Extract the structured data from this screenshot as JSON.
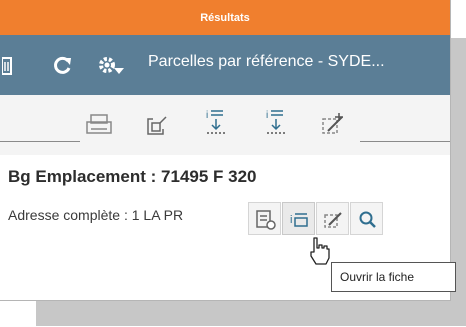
{
  "window": {
    "title": "Résultats"
  },
  "layer": {
    "title": "Parcelles par référence - SYDE..."
  },
  "record": {
    "emplacement_label": "Bg Emplacement : ",
    "emplacement_value": "71495 F 320",
    "adresse_label": "Adresse complète : ",
    "adresse_value": "1 LA PR"
  },
  "tooltip": {
    "text": "Ouvrir la fiche"
  },
  "icons": {
    "layer_bar": [
      "delete-icon",
      "refresh-icon",
      "settings-icon"
    ],
    "toolbar": [
      "print-icon",
      "zoom-to-icon",
      "open-form-icon",
      "open-form-alt-icon",
      "edit-icon"
    ],
    "actions": [
      "attribute-table-icon",
      "open-form-icon",
      "edit-icon",
      "search-icon"
    ]
  },
  "colors": {
    "title_bar": "#f07f2e",
    "layer_bar": "#5b7e96",
    "icon_blue": "#2f6e8f"
  }
}
